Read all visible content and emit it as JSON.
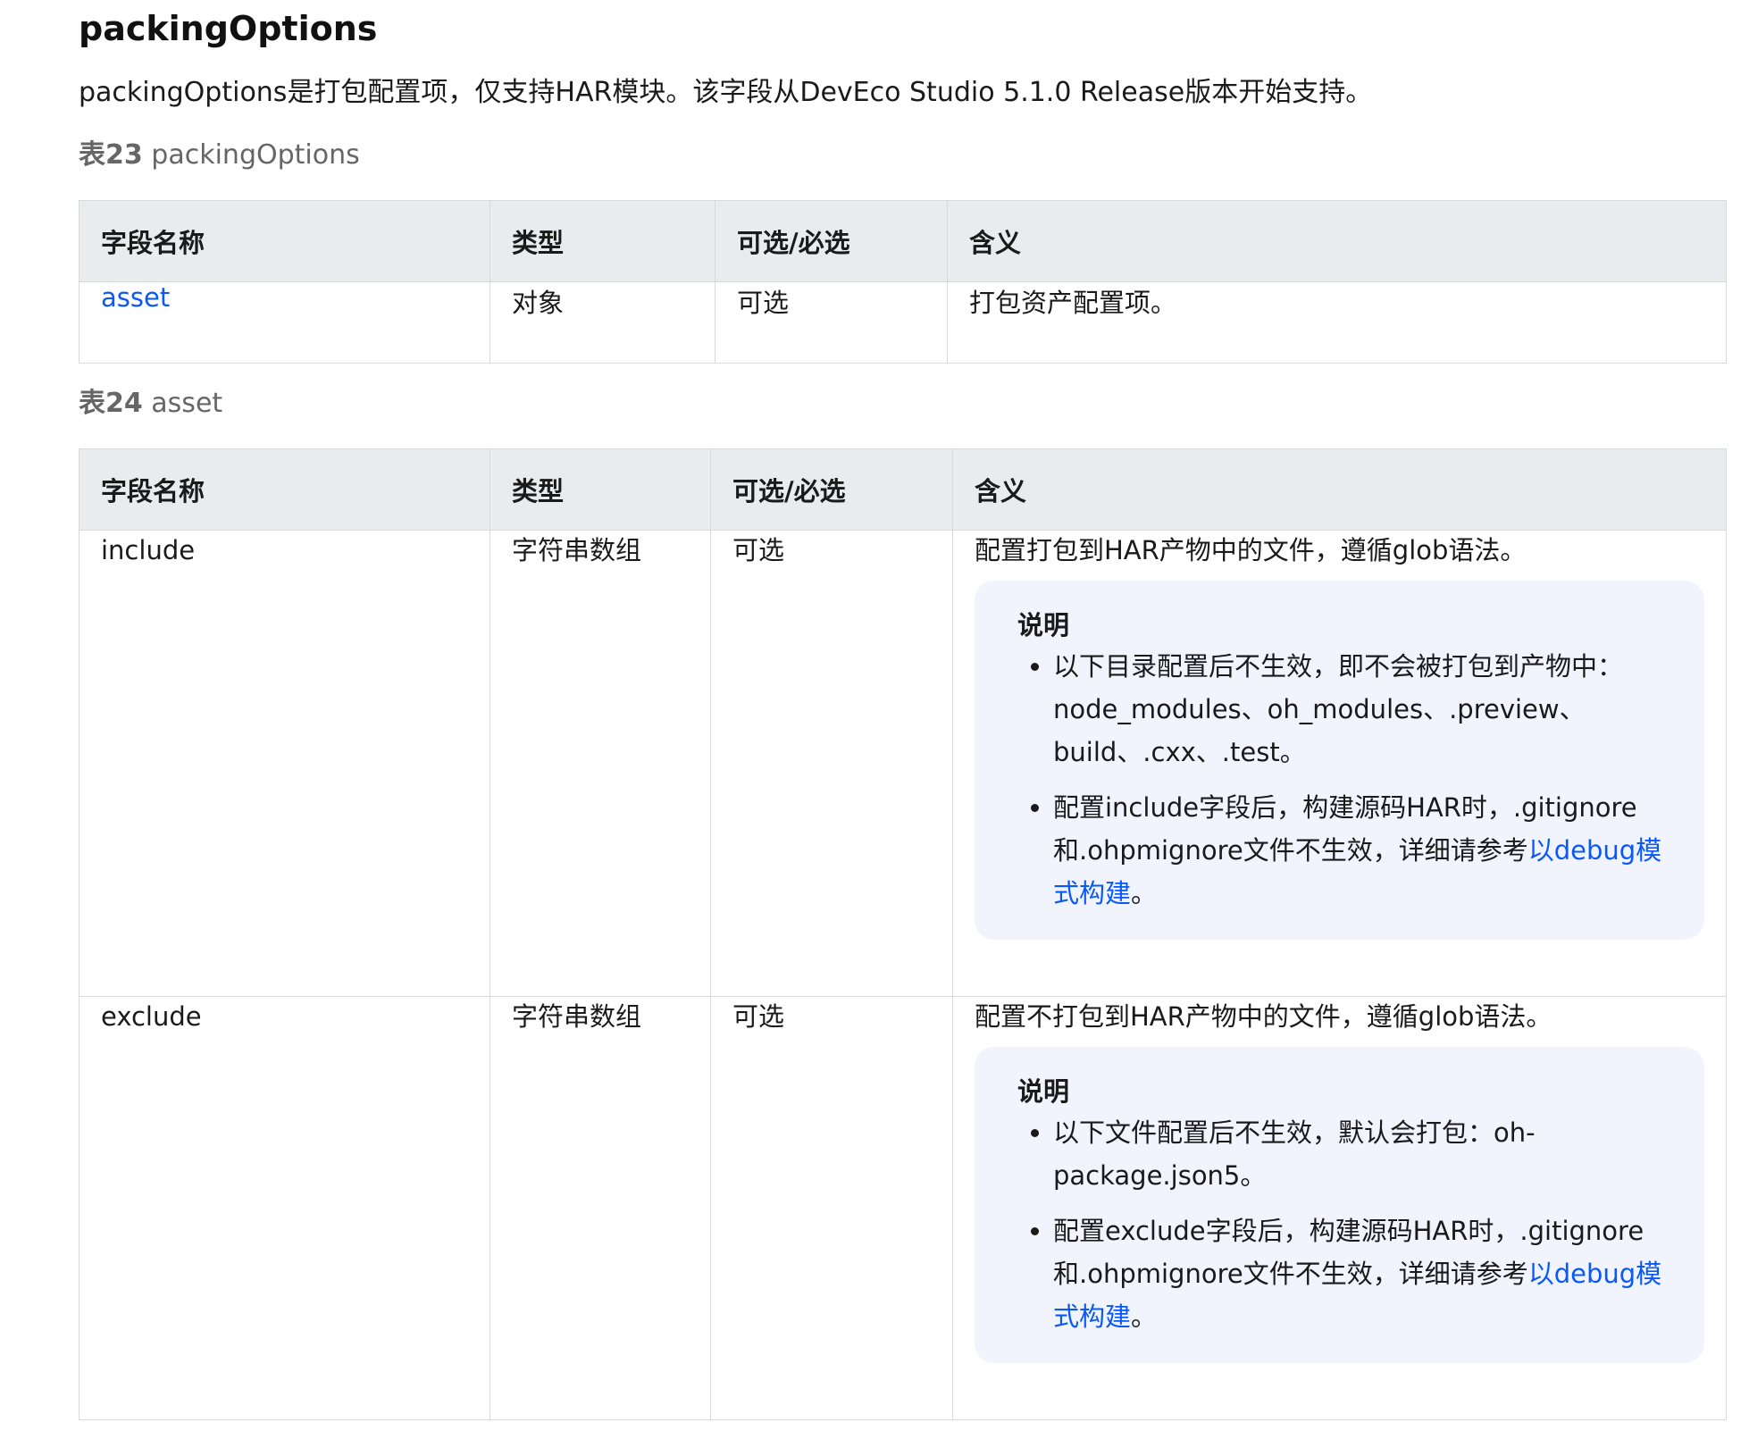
{
  "section": {
    "title": "packingOptions",
    "intro": "packingOptions是打包配置项，仅支持HAR模块。该字段从DevEco Studio 5.1.0 Release版本开始支持。"
  },
  "table23": {
    "caption_num": "表23",
    "caption_name": "packingOptions",
    "headers": [
      "字段名称",
      "类型",
      "可选/必选",
      "含义"
    ],
    "rows": [
      {
        "name": "asset",
        "type": "对象",
        "required": "可选",
        "meaning": "打包资产配置项。"
      }
    ]
  },
  "table24": {
    "caption_num": "表24",
    "caption_name": "asset",
    "headers": [
      "字段名称",
      "类型",
      "可选/必选",
      "含义"
    ],
    "rows": [
      {
        "name": "include",
        "type": "字符串数组",
        "required": "可选",
        "meaning": "配置打包到HAR产物中的文件，遵循glob语法。",
        "note_title": "说明",
        "note_item1": "以下目录配置后不生效，即不会被打包到产物中：node_modules、oh_modules、.preview、build、.cxx、.test。",
        "note_item2_prefix": "配置include字段后，构建源码HAR时，.gitignore和.ohpmignore文件不生效，详细请参考",
        "note_item2_link": "以debug模式构建",
        "note_item2_suffix": "。"
      },
      {
        "name": "exclude",
        "type": "字符串数组",
        "required": "可选",
        "meaning": "配置不打包到HAR产物中的文件，遵循glob语法。",
        "note_title": "说明",
        "note_item1": "以下文件配置后不生效，默认会打包：oh-package.json5。",
        "note_item2_prefix": "配置exclude字段后，构建源码HAR时，.gitignore和.ohpmignore文件不生效，详细请参考",
        "note_item2_link": "以debug模式构建",
        "note_item2_suffix": "。"
      }
    ]
  },
  "colors": {
    "link": "#0a59f7",
    "header_bg": "#eaebee",
    "note_bg": "#f1f4fd"
  }
}
